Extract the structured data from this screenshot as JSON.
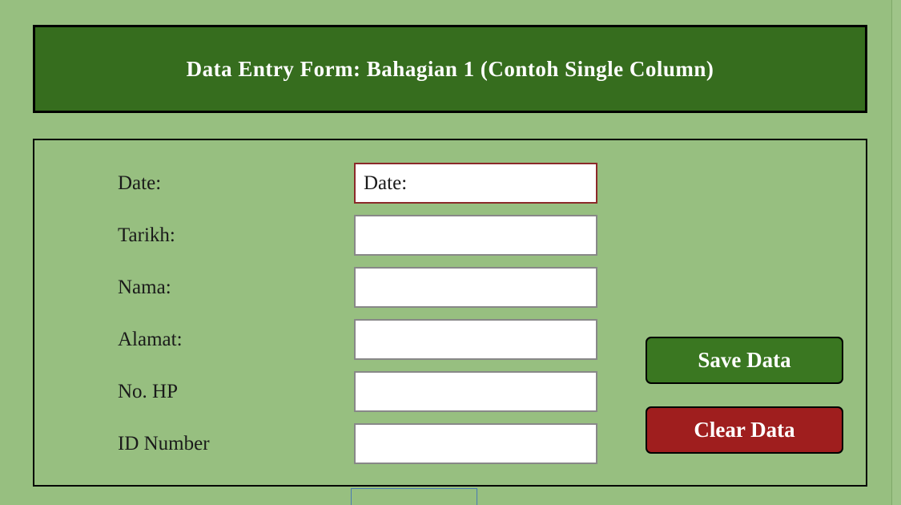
{
  "header": {
    "title": "Data Entry Form:  Bahagian 1 (Contoh Single Column)"
  },
  "form": {
    "fields": [
      {
        "label": "Date:",
        "value": "Date:"
      },
      {
        "label": "Tarikh:",
        "value": ""
      },
      {
        "label": "Nama:",
        "value": ""
      },
      {
        "label": "Alamat:",
        "value": ""
      },
      {
        "label": "No. HP",
        "value": ""
      },
      {
        "label": "ID Number",
        "value": ""
      }
    ]
  },
  "buttons": {
    "save": "Save Data",
    "clear": "Clear Data"
  }
}
